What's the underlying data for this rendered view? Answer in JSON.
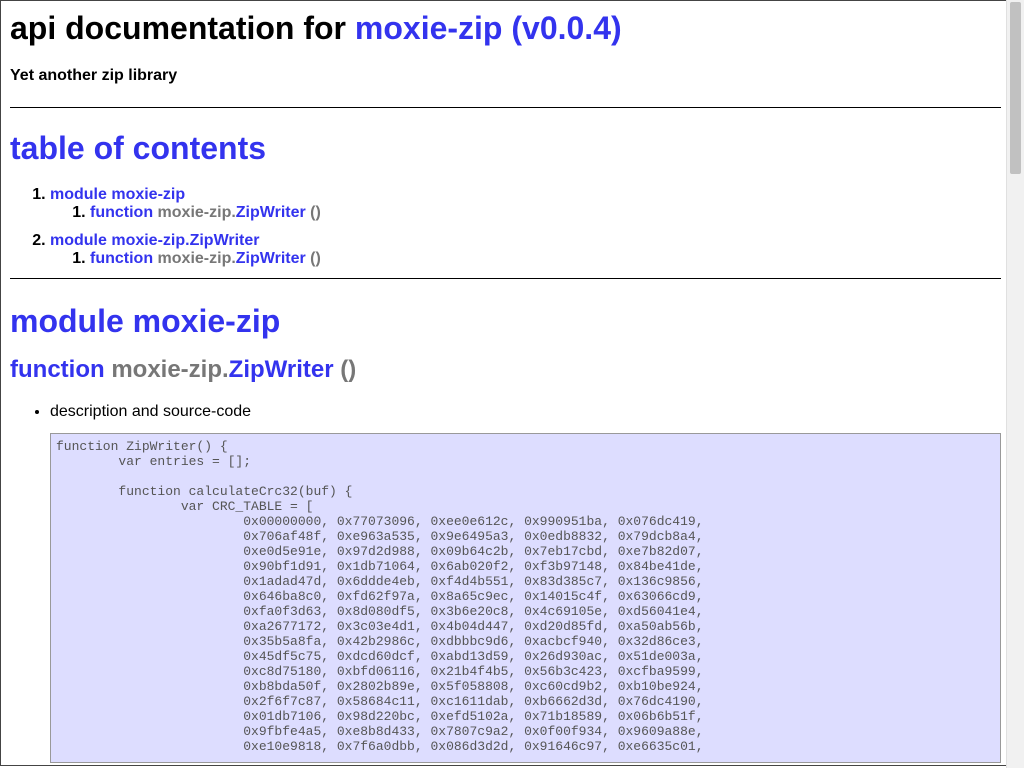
{
  "header": {
    "title_prefix": "api documentation for",
    "title_link": "moxie-zip (v0.0.4)",
    "subtitle": "Yet another zip library"
  },
  "toc": {
    "heading": "table of contents",
    "items": [
      {
        "label": "module moxie-zip",
        "children": [
          {
            "keyword": "function",
            "prefix": "moxie-zip.",
            "name": "ZipWriter",
            "parens": "()"
          }
        ]
      },
      {
        "label": "module moxie-zip.ZipWriter",
        "children": [
          {
            "keyword": "function",
            "prefix": "moxie-zip.",
            "name": "ZipWriter",
            "parens": "()"
          }
        ]
      }
    ]
  },
  "module": {
    "heading": "module moxie-zip",
    "function": {
      "keyword": "function",
      "prefix": "moxie-zip.",
      "name": "ZipWriter",
      "parens": "()"
    },
    "bullet": "description and source-code",
    "code": "function ZipWriter() {\n        var entries = [];\n\n        function calculateCrc32(buf) {\n                var CRC_TABLE = [\n                        0x00000000, 0x77073096, 0xee0e612c, 0x990951ba, 0x076dc419,\n                        0x706af48f, 0xe963a535, 0x9e6495a3, 0x0edb8832, 0x79dcb8a4,\n                        0xe0d5e91e, 0x97d2d988, 0x09b64c2b, 0x7eb17cbd, 0xe7b82d07,\n                        0x90bf1d91, 0x1db71064, 0x6ab020f2, 0xf3b97148, 0x84be41de,\n                        0x1adad47d, 0x6ddde4eb, 0xf4d4b551, 0x83d385c7, 0x136c9856,\n                        0x646ba8c0, 0xfd62f97a, 0x8a65c9ec, 0x14015c4f, 0x63066cd9,\n                        0xfa0f3d63, 0x8d080df5, 0x3b6e20c8, 0x4c69105e, 0xd56041e4,\n                        0xa2677172, 0x3c03e4d1, 0x4b04d447, 0xd20d85fd, 0xa50ab56b,\n                        0x35b5a8fa, 0x42b2986c, 0xdbbbc9d6, 0xacbcf940, 0x32d86ce3,\n                        0x45df5c75, 0xdcd60dcf, 0xabd13d59, 0x26d930ac, 0x51de003a,\n                        0xc8d75180, 0xbfd06116, 0x21b4f4b5, 0x56b3c423, 0xcfba9599,\n                        0xb8bda50f, 0x2802b89e, 0x5f058808, 0xc60cd9b2, 0xb10be924,\n                        0x2f6f7c87, 0x58684c11, 0xc1611dab, 0xb6662d3d, 0x76dc4190,\n                        0x01db7106, 0x98d220bc, 0xefd5102a, 0x71b18589, 0x06b6b51f,\n                        0x9fbfe4a5, 0xe8b8d433, 0x7807c9a2, 0x0f00f934, 0x9609a88e,\n                        0xe10e9818, 0x7f6a0dbb, 0x086d3d2d, 0x91646c97, 0xe6635c01,"
  },
  "colors": {
    "link": "#3333ee",
    "muted": "#777777",
    "code_background": "#ddddff"
  }
}
